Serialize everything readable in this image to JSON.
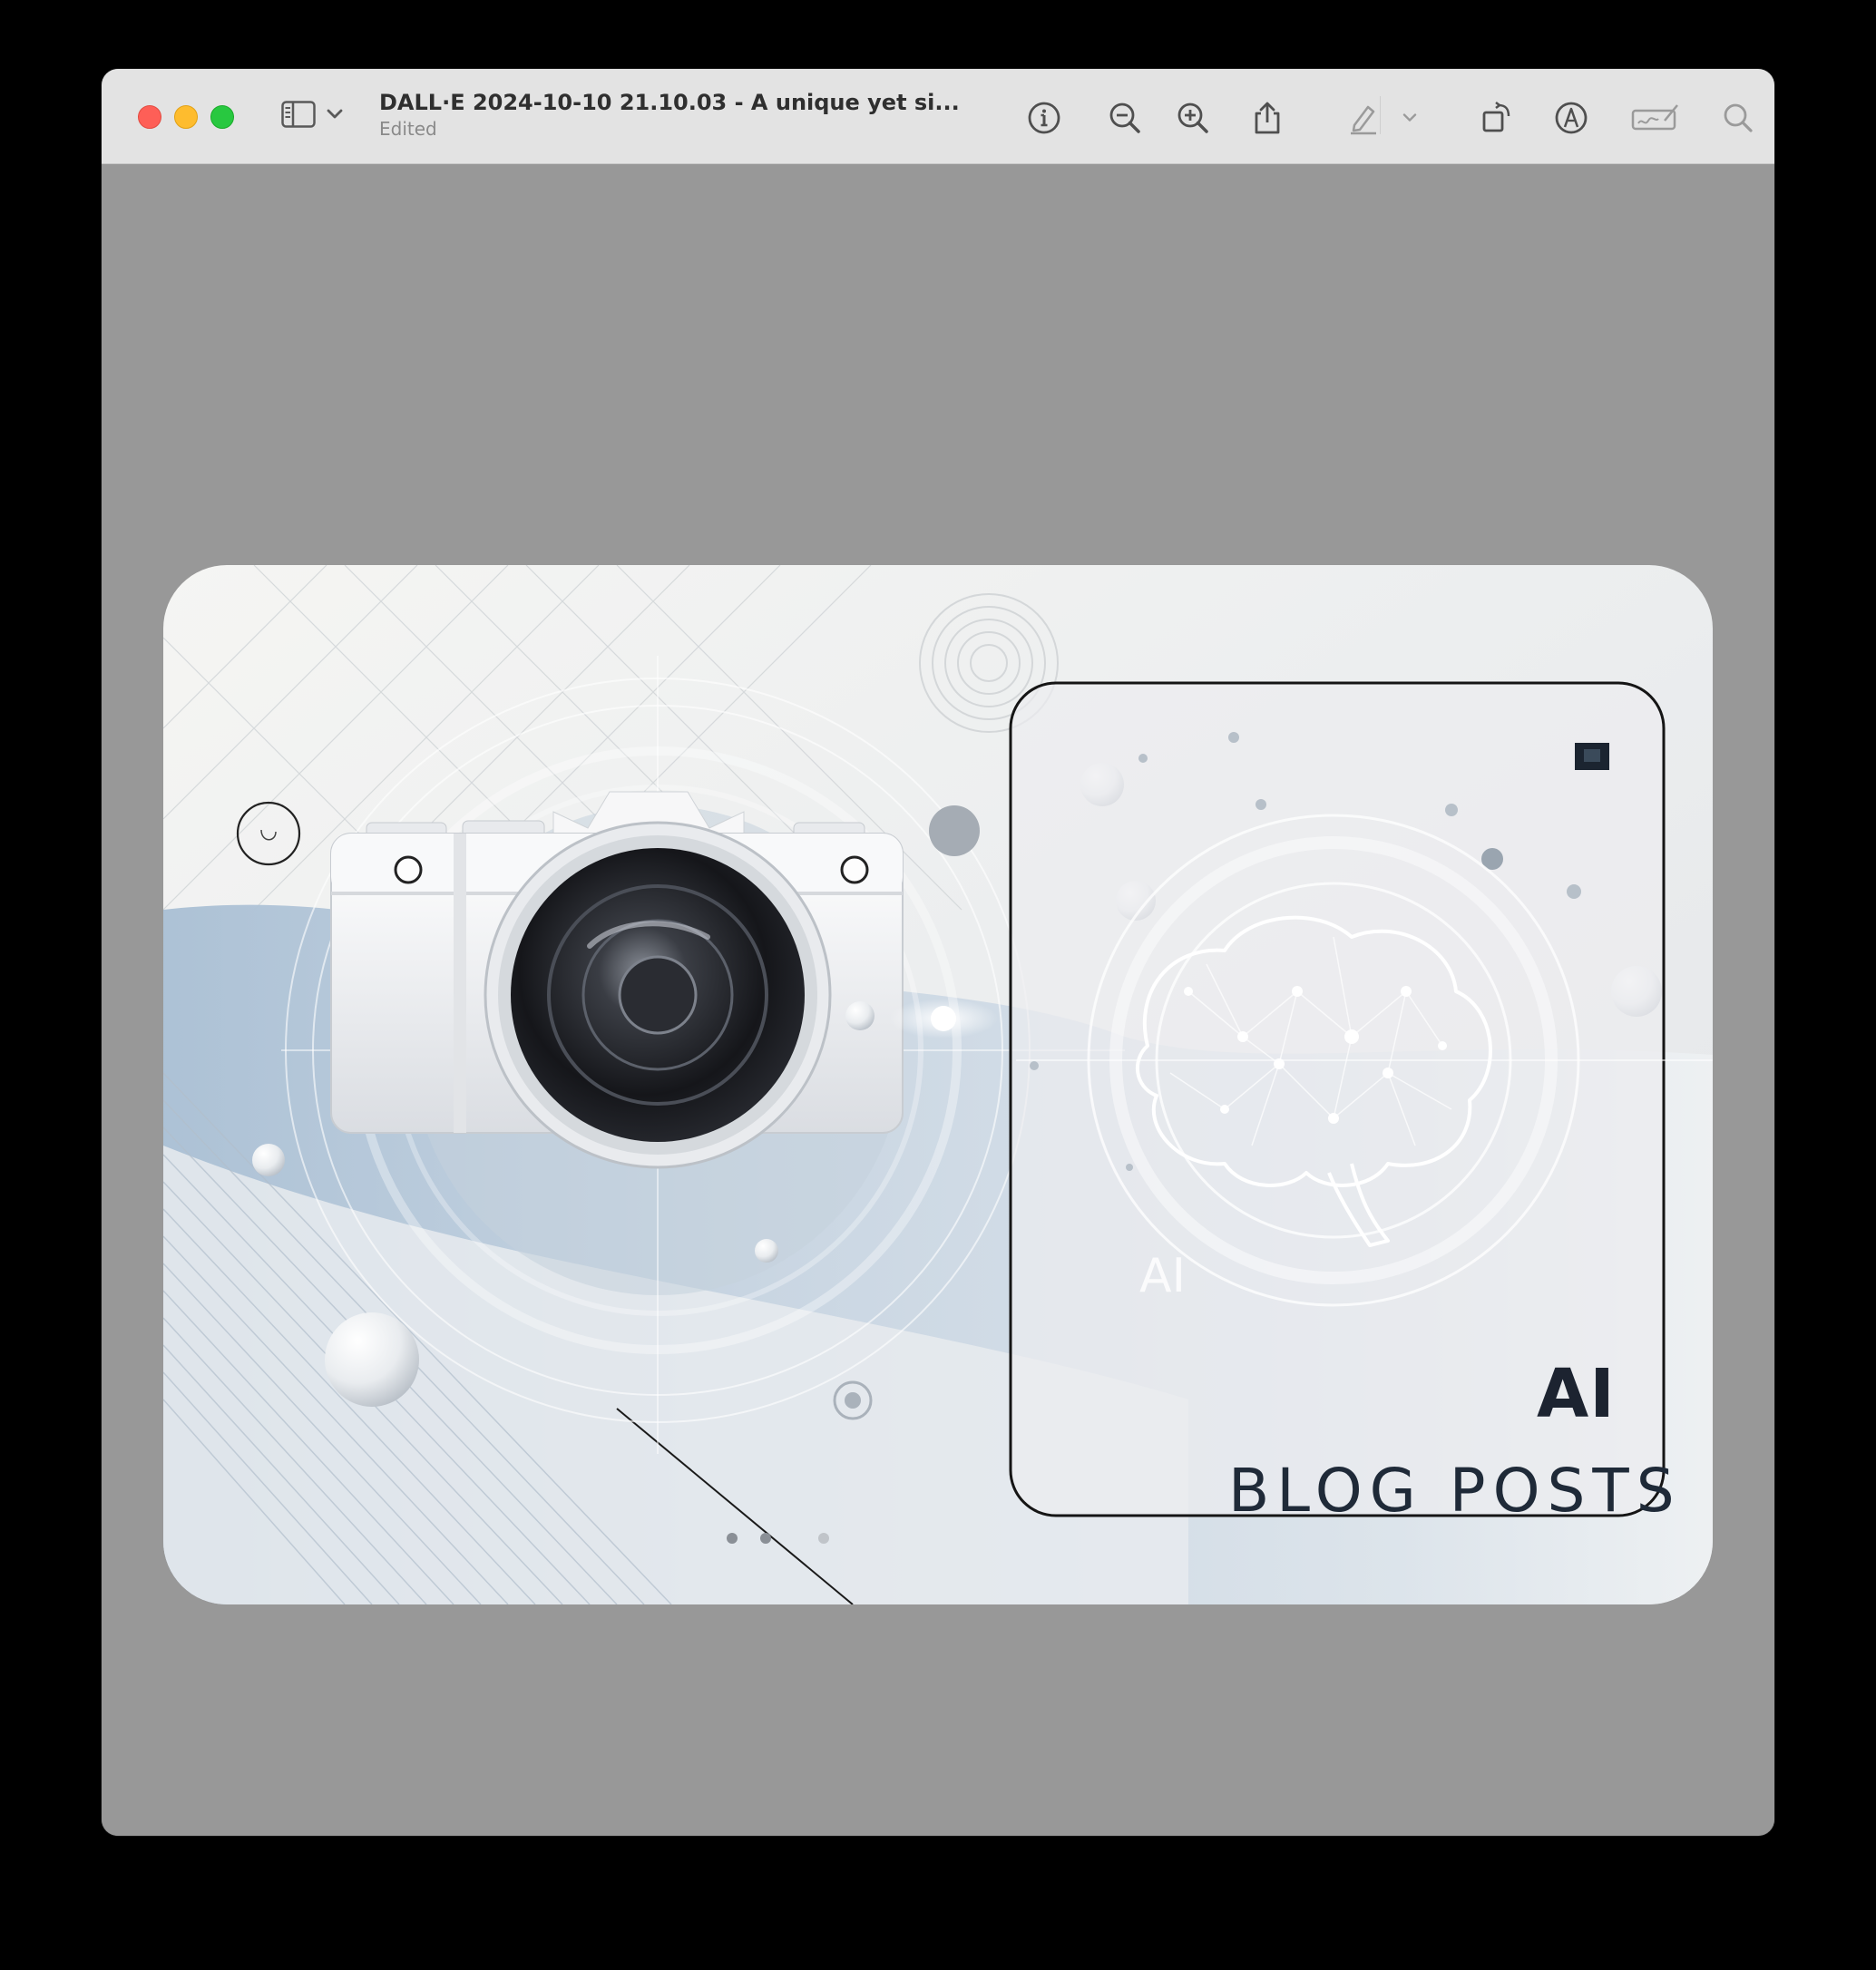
{
  "window": {
    "title": "DALL·E 2024-10-10 21.10.03 - A unique yet si...",
    "subtitle": "Edited"
  },
  "toolbar": {
    "buttons": [
      "sidebar-toggle-icon",
      "chevron-down-icon",
      "info-icon",
      "zoom-out-icon",
      "zoom-in-icon",
      "share-icon",
      "highlight-pen-icon",
      "chevron-down-icon",
      "rotate-icon",
      "markup-icon",
      "signature-icon",
      "search-icon"
    ]
  },
  "image": {
    "text_ai_large": "AI",
    "text_blog_posts": "BLOG POSTS",
    "text_ai_small": "AI",
    "colors": {
      "card_bg": "#efefef",
      "accent_blue": "#b8c8d8",
      "lens_dark": "#1e1f24",
      "outline": "#111111"
    }
  }
}
